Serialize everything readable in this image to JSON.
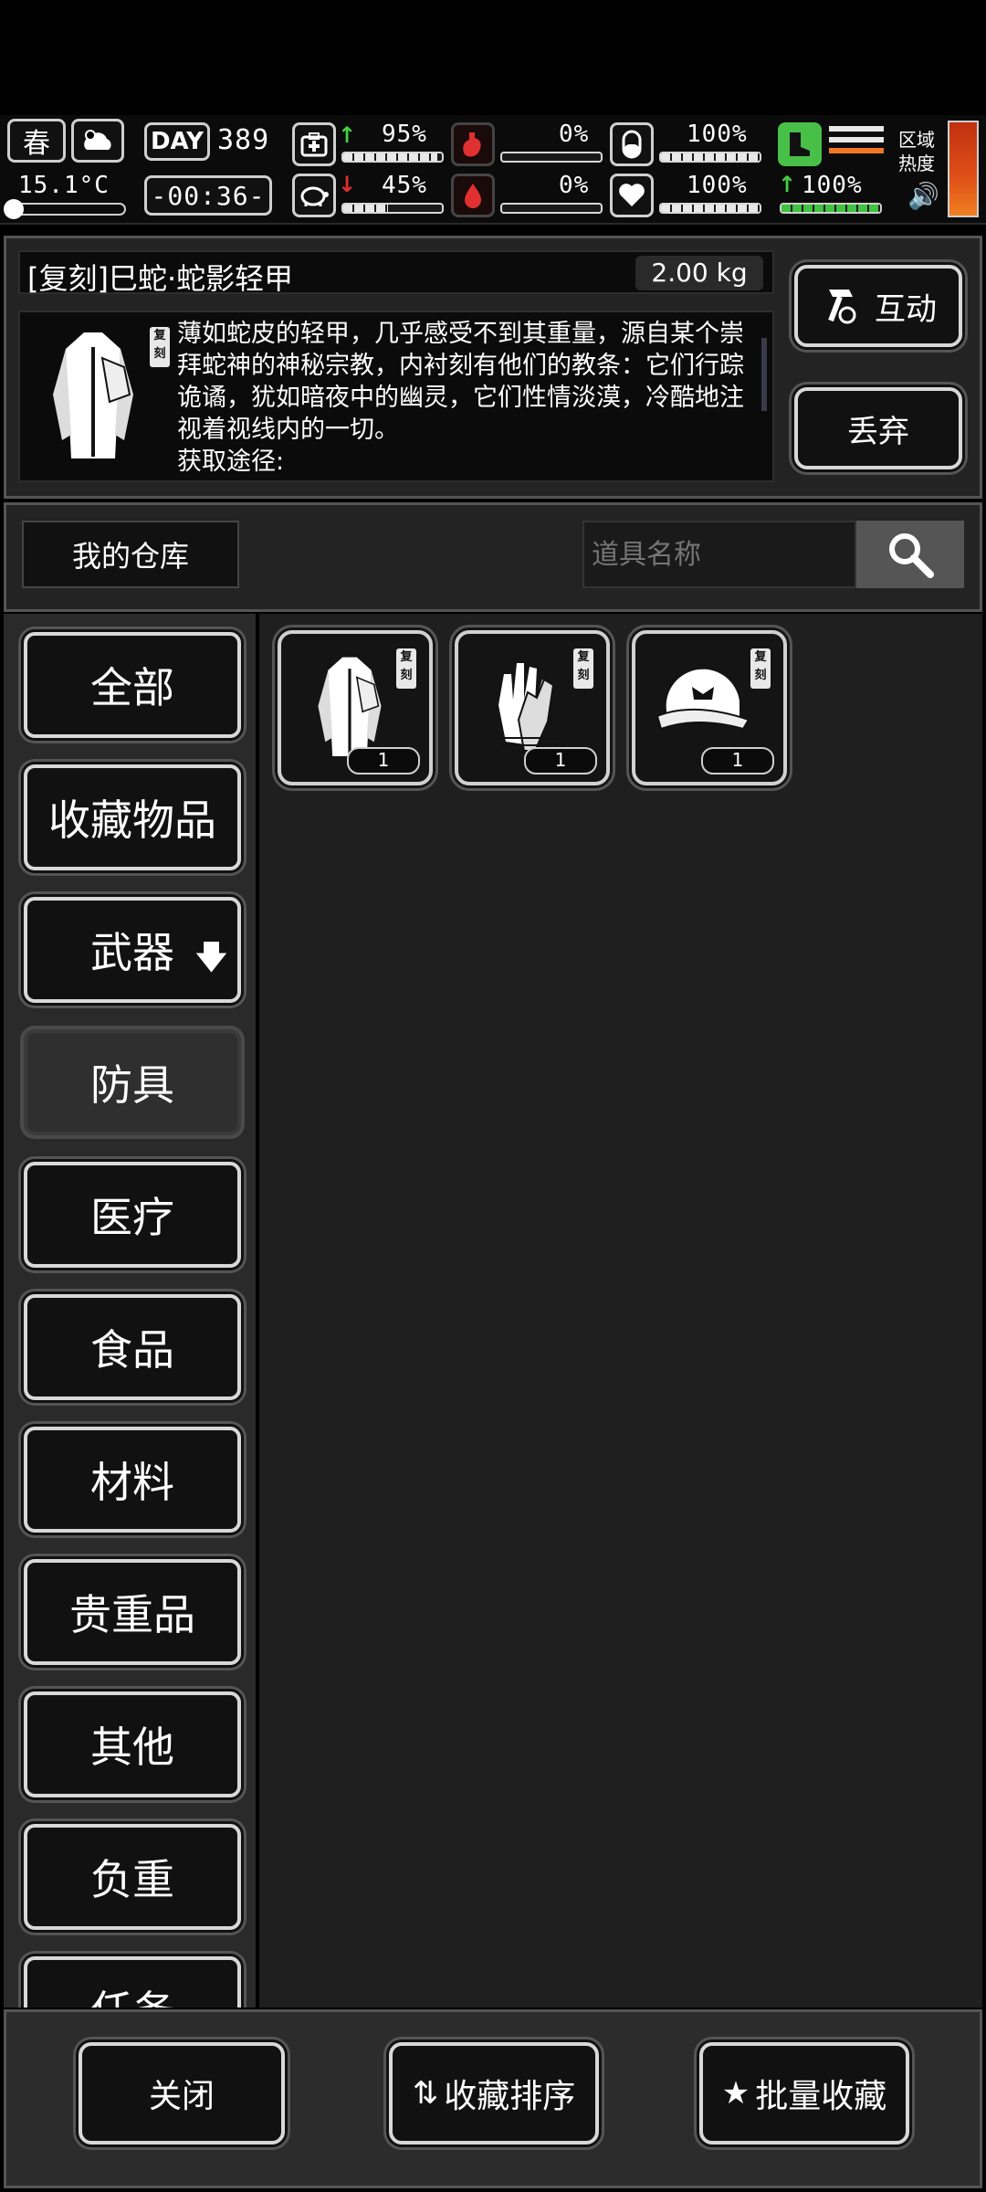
{
  "hud": {
    "season": "春",
    "day_label": "DAY",
    "day_value": "389",
    "temperature": "15.1°C",
    "time": "-00:36-",
    "health_pct": "95%",
    "stamina_pct": "45%",
    "hunger_pct": "0%",
    "thirst_pct": "0%",
    "mental_pct": "100%",
    "heart_pct": "100%",
    "boot_pct": "100%",
    "zone_heat_label": "区域\n热度",
    "bars": {
      "health": 0.95,
      "stamina": 0.45,
      "hunger": 0.0,
      "thirst": 0.0,
      "mental": 1.0,
      "heart": 1.0,
      "boot": 1.0
    }
  },
  "item_detail": {
    "name": "[复刻]巳蛇·蛇影轻甲",
    "weight": "2.00 kg",
    "badge": "复刻",
    "description": "薄如蛇皮的轻甲，几乎感受不到其重量，源自某个崇拜蛇神的神秘宗教，内衬刻有他们的教条：它们行踪诡谲，犹如暗夜中的幽灵，它们性情淡漠，冷酷地注视着视线内的一切。",
    "source": "获取途径:",
    "interact_label": "互动",
    "discard_label": "丢弃"
  },
  "storage": {
    "title": "我的仓库",
    "search_placeholder": "道具名称"
  },
  "categories": [
    {
      "label": "全部"
    },
    {
      "label": "收藏物品"
    },
    {
      "label": "武器"
    },
    {
      "label": "防具"
    },
    {
      "label": "医疗"
    },
    {
      "label": "食品"
    },
    {
      "label": "材料"
    },
    {
      "label": "贵重品"
    },
    {
      "label": "其他"
    },
    {
      "label": "负重"
    },
    {
      "label": "任务"
    }
  ],
  "items": [
    {
      "icon": "armor-coat-icon",
      "badge": "复刻",
      "qty": "1"
    },
    {
      "icon": "scaled-gloves-icon",
      "badge": "复刻",
      "qty": "1"
    },
    {
      "icon": "cap-icon",
      "badge": "复刻",
      "qty": "1"
    }
  ],
  "bottom_bar": {
    "close_label": "关闭",
    "sort_label": "收藏排序",
    "batch_label": "批量收藏"
  },
  "colors": {
    "accent_green": "#43d043",
    "accent_red": "#e03030",
    "heat_gradient_top": "#c03010",
    "heat_gradient_bottom": "#f08020"
  }
}
